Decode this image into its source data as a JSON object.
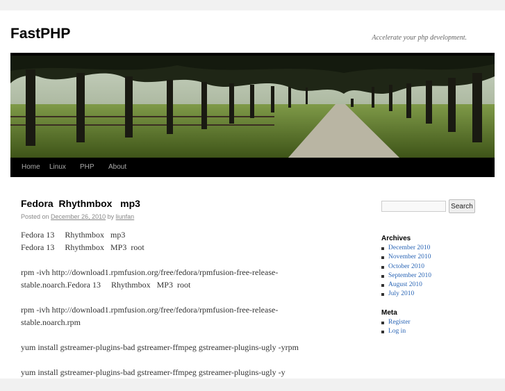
{
  "site": {
    "title": "FastPHP",
    "description": "Accelerate your php development."
  },
  "nav": {
    "items": [
      {
        "label": "Home"
      },
      {
        "label": "Linux"
      },
      {
        "label": "PHP"
      },
      {
        "label": "About"
      }
    ]
  },
  "post": {
    "title": "Fedora  Rhythmbox   mp3",
    "meta": {
      "posted_on": "Posted on",
      "date": "December 26, 2010",
      "by": "by",
      "author": "liunfan"
    },
    "paragraphs": [
      "Fedora 13     Rhythmbox   mp3\nFedora 13     Rhythmbox   MP3  root",
      "rpm -ivh http://download1.rpmfusion.org/free/fedora/rpmfusion-free-release-stable.noarch.Fedora 13     Rhythmbox   MP3  root",
      "rpm -ivh http://download1.rpmfusion.org/free/fedora/rpmfusion-free-release-stable.noarch.rpm",
      "yum install gstreamer-plugins-bad gstreamer-ffmpeg gstreamer-plugins-ugly -yrpm",
      "yum install gstreamer-plugins-bad gstreamer-ffmpeg gstreamer-plugins-ugly -y"
    ]
  },
  "sidebar": {
    "search": {
      "placeholder": "",
      "button_label": "Search"
    },
    "archives": {
      "title": "Archives",
      "items": [
        "December 2010",
        "November 2010",
        "October 2010",
        "September 2010",
        "August 2010",
        "July 2010"
      ]
    },
    "meta": {
      "title": "Meta",
      "items": [
        "Register",
        "Log in"
      ]
    }
  },
  "colors": {
    "link": "#2a65b5",
    "nav_bg": "#000000",
    "nav_text": "#aaaaaa"
  }
}
